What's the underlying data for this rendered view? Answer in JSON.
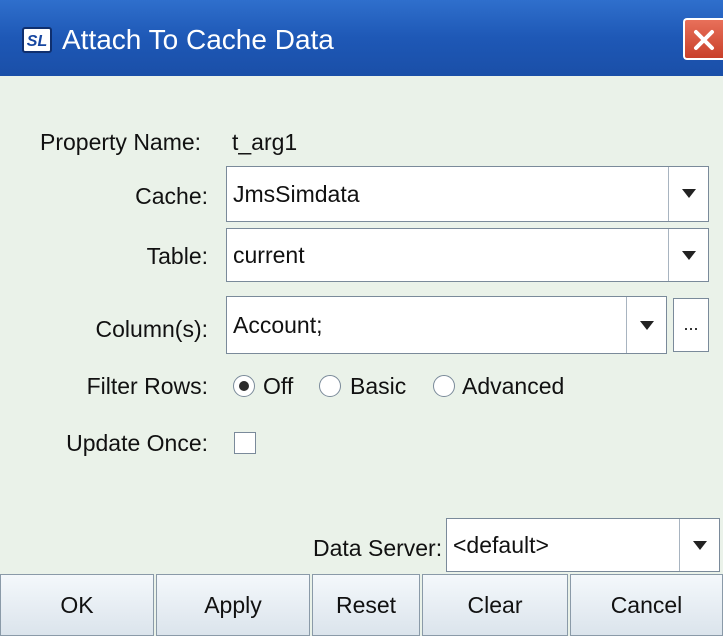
{
  "window": {
    "title": "Attach To Cache Data",
    "icon_text": "SL"
  },
  "form": {
    "property_name_label": "Property Name:",
    "property_name_value": "t_arg1",
    "cache_label": "Cache:",
    "cache_value": "JmsSimdata",
    "table_label": "Table:",
    "table_value": "current",
    "columns_label": "Column(s):",
    "columns_value": "Account;",
    "columns_more_button": "...",
    "filter_rows_label": "Filter Rows:",
    "filter_options": [
      {
        "label": "Off",
        "checked": true
      },
      {
        "label": "Basic",
        "checked": false
      },
      {
        "label": "Advanced",
        "checked": false
      }
    ],
    "update_once_label": "Update Once:",
    "update_once_checked": false,
    "data_server_label": "Data Server:",
    "data_server_value": "<default>"
  },
  "buttons": {
    "ok": "OK",
    "apply": "Apply",
    "reset": "Reset",
    "clear": "Clear",
    "cancel": "Cancel"
  },
  "colors": {
    "titlebar": "#1e58b6",
    "dialog_background": "#eaf2e9",
    "close_button": "#c9402a"
  }
}
